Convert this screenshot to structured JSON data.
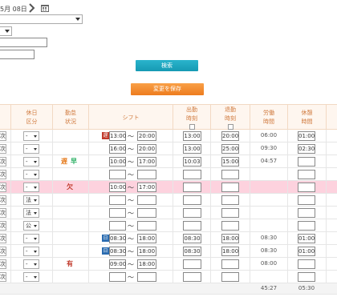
{
  "header": {
    "date_text": "5月 08日",
    "search_label": "検索",
    "save_label": "変更を保存"
  },
  "columns": {
    "kubun": [
      "休日",
      "区分"
    ],
    "kintai": [
      "勤怠",
      "状況"
    ],
    "shift": "シフト",
    "start": [
      "出勤",
      "時刻"
    ],
    "end": [
      "退勤",
      "時刻"
    ],
    "work": [
      "労働",
      "時間"
    ],
    "rest": [
      "休憩",
      "時間"
    ]
  },
  "colors": {
    "header_bg": "#fef6ef",
    "header_text": "#d07a3e",
    "absent_row": "#fdd2de",
    "search_btn": "#169ab3",
    "save_btn": "#ed7c1e"
  },
  "rows": [
    {
      "cut": "次",
      "kubun": "-",
      "status": "",
      "status2": "",
      "icon": "遅",
      "icon_color": "#c0392b",
      "shift_start": "13:00",
      "shift_end": "20:00",
      "start": "13:00",
      "end": "20:00",
      "work": "06:00",
      "rest": "01:00",
      "pink": false
    },
    {
      "cut": "次",
      "kubun": "-",
      "status": "",
      "status2": "",
      "icon": "",
      "icon_color": "",
      "shift_start": "16:00",
      "shift_end": "20:00",
      "start": "13:00",
      "end": "25:00",
      "work": "09:30",
      "rest": "02:30",
      "pink": false
    },
    {
      "cut": "次",
      "kubun": "-",
      "status": "遅",
      "status2": "早",
      "icon": "",
      "icon_color": "",
      "shift_start": "10:00",
      "shift_end": "17:00",
      "start": "10:03",
      "end": "15:00",
      "work": "04:57",
      "rest": "",
      "pink": false
    },
    {
      "cut": "次",
      "kubun": "-",
      "status": "",
      "status2": "",
      "icon": "",
      "icon_color": "",
      "shift_start": "",
      "shift_end": "",
      "start": "",
      "end": "",
      "work": "",
      "rest": "",
      "pink": false
    },
    {
      "cut": "次",
      "kubun": "-",
      "status": "欠",
      "status2": "",
      "icon": "",
      "icon_color": "",
      "shift_start": "10:00",
      "shift_end": "17:00",
      "start": "",
      "end": "",
      "work": "",
      "rest": "",
      "pink": true
    },
    {
      "cut": "次",
      "kubun": "法",
      "status": "",
      "status2": "",
      "icon": "",
      "icon_color": "",
      "shift_start": "",
      "shift_end": "",
      "start": "",
      "end": "",
      "work": "",
      "rest": "",
      "pink": false
    },
    {
      "cut": "次",
      "kubun": "法",
      "status": "",
      "status2": "",
      "icon": "",
      "icon_color": "",
      "shift_start": "",
      "shift_end": "",
      "start": "",
      "end": "",
      "work": "",
      "rest": "",
      "pink": false
    },
    {
      "cut": "次",
      "kubun": "公",
      "status": "",
      "status2": "",
      "icon": "",
      "icon_color": "",
      "shift_start": "",
      "shift_end": "",
      "start": "",
      "end": "",
      "work": "",
      "rest": "",
      "pink": false
    },
    {
      "cut": "次",
      "kubun": "-",
      "status": "",
      "status2": "",
      "icon": "日",
      "icon_color": "#2b6cb0",
      "shift_start": "08:30",
      "shift_end": "18:00",
      "start": "08:30",
      "end": "18:00",
      "work": "08:30",
      "rest": "01:00",
      "pink": false
    },
    {
      "cut": "次",
      "kubun": "-",
      "status": "",
      "status2": "",
      "icon": "日",
      "icon_color": "#2b6cb0",
      "shift_start": "08:30",
      "shift_end": "18:00",
      "start": "08:30",
      "end": "18:00",
      "work": "08:30",
      "rest": "01:00",
      "pink": false
    },
    {
      "cut": "次",
      "kubun": "-",
      "status": "有",
      "status2": "",
      "icon": "",
      "icon_color": "",
      "shift_start": "09:00",
      "shift_end": "18:00",
      "start": "",
      "end": "",
      "work": "08:00",
      "rest": "",
      "pink": false
    },
    {
      "cut": "次",
      "kubun": "-",
      "status": "",
      "status2": "",
      "icon": "",
      "icon_color": "",
      "shift_start": "",
      "shift_end": "",
      "start": "",
      "end": "",
      "work": "",
      "rest": "",
      "pink": false
    }
  ],
  "totals": {
    "work": "45:27",
    "rest": "05:30"
  }
}
